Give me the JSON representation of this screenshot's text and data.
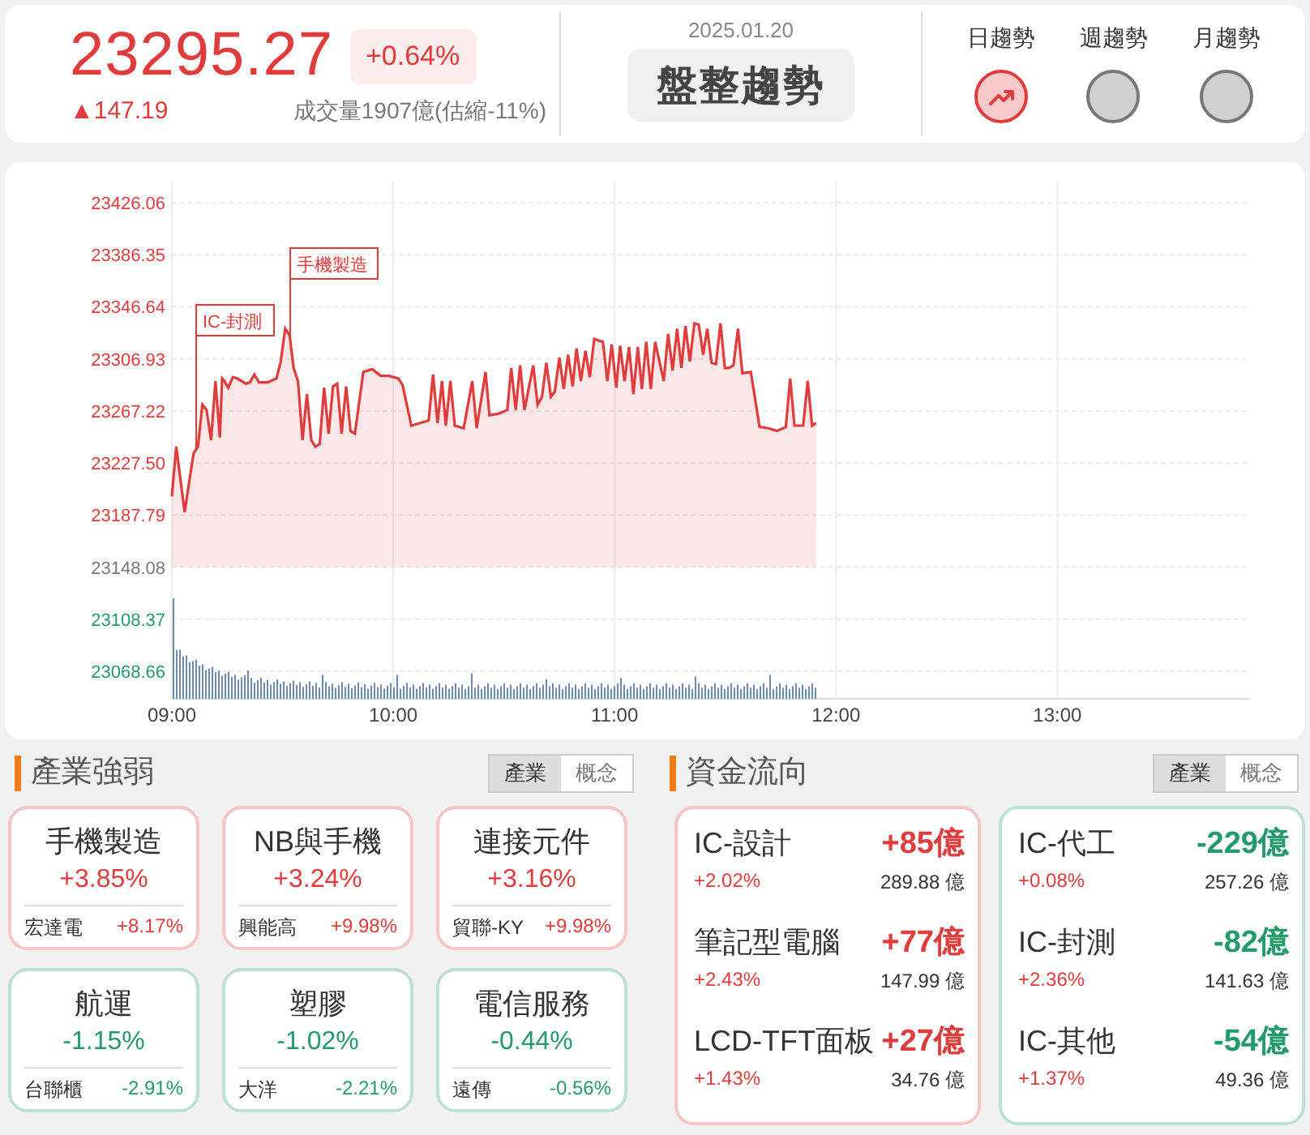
{
  "header": {
    "price": "23295.27",
    "change_percent": "+0.64%",
    "change": "▲147.19",
    "volume": "成交量1907億(估縮-11%)",
    "date": "2025.01.20",
    "status": "盤整趨勢",
    "trends": [
      {
        "label": "日趨勢",
        "selected": true
      },
      {
        "label": "週趨勢",
        "selected": false
      },
      {
        "label": "月趨勢",
        "selected": false
      }
    ]
  },
  "chart": {
    "chart_data": {
      "type": "area",
      "xticks": [
        {
          "value": 9,
          "label": "09:00"
        },
        {
          "value": 10,
          "label": "10:00"
        },
        {
          "value": 11,
          "label": "11:00"
        },
        {
          "value": 12,
          "label": "12:00"
        },
        {
          "value": 13,
          "label": "13:00"
        }
      ],
      "yticks": [
        23426.06,
        23386.35,
        23346.64,
        23306.93,
        23267.22,
        {
          "value": 23227.5,
          "label": "23227.50"
        },
        23187.79,
        23148.08,
        23108.37,
        23068.66
      ],
      "xlim": [
        9,
        13.87
      ],
      "ylim": [
        23047.7,
        23442.1
      ],
      "grid": true,
      "series": [
        {
          "color": "#e03c3c",
          "x": [
            9,
            9.02,
            9.058,
            9.098,
            9.118,
            9.138,
            9.157,
            9.177,
            9.197,
            9.217,
            9.227,
            9.237,
            9.255,
            9.275,
            9.295,
            9.335,
            9.353,
            9.373,
            9.393,
            9.433,
            9.472,
            9.492,
            9.512,
            9.532,
            9.55,
            9.57,
            9.59,
            9.61,
            9.63,
            9.648,
            9.668,
            9.688,
            9.708,
            9.728,
            9.747,
            9.767,
            9.787,
            9.807,
            9.827,
            9.865,
            9.905,
            9.943,
            9.983,
            10.023,
            10.042,
            10.082,
            10.122,
            10.16,
            10.18,
            10.2,
            10.22,
            10.238,
            10.258,
            10.278,
            10.318,
            10.357,
            10.377,
            10.417,
            10.435,
            10.475,
            10.515,
            10.533,
            10.553,
            10.573,
            10.593,
            10.632,
            10.652,
            10.672,
            10.692,
            10.712,
            10.73,
            10.75,
            10.77,
            10.79,
            10.81,
            10.828,
            10.848,
            10.868,
            10.888,
            10.908,
            10.947,
            10.967,
            10.987,
            11.007,
            11.025,
            11.045,
            11.065,
            11.085,
            11.105,
            11.123,
            11.143,
            11.163,
            11.183,
            11.222,
            11.242,
            11.262,
            11.282,
            11.302,
            11.32,
            11.34,
            11.36,
            11.38,
            11.4,
            11.418,
            11.438,
            11.458,
            11.478,
            11.498,
            11.517,
            11.537,
            11.557,
            11.577,
            11.615,
            11.655,
            11.695,
            11.733,
            11.773,
            11.793,
            11.812,
            11.852,
            11.872,
            11.892,
            11.91
          ],
          "values": [
            23202,
            23240,
            23190,
            23235,
            23240,
            23272,
            23268,
            23245,
            23290,
            23247,
            23292,
            23290,
            23285,
            23293,
            23292,
            23288,
            23289,
            23295,
            23289,
            23289,
            23292,
            23305,
            23330,
            23325,
            23300,
            23290,
            23245,
            23280,
            23245,
            23240,
            23242,
            23285,
            23250,
            23286,
            23288,
            23250,
            23286,
            23252,
            23250,
            23297,
            23299,
            23294,
            23294,
            23292,
            23287,
            23256,
            23258,
            23260,
            23295,
            23258,
            23290,
            23256,
            23290,
            23256,
            23254,
            23290,
            23254,
            23297,
            23264,
            23265,
            23268,
            23300,
            23268,
            23302,
            23268,
            23302,
            23272,
            23278,
            23304,
            23278,
            23282,
            23308,
            23284,
            23310,
            23286,
            23315,
            23290,
            23313,
            23293,
            23322,
            23320,
            23290,
            23318,
            23285,
            23317,
            23290,
            23316,
            23280,
            23316,
            23284,
            23320,
            23284,
            23320,
            23290,
            23326,
            23298,
            23330,
            23300,
            23332,
            23305,
            23334,
            23333,
            23310,
            23330,
            23304,
            23303,
            23334,
            23300,
            23300,
            23302,
            23330,
            23296,
            23297,
            23255,
            23254,
            23252,
            23255,
            23292,
            23256,
            23256,
            23290,
            23256,
            23258
          ]
        }
      ],
      "annotations": [
        "手機製造",
        "IC-封測"
      ]
    }
  },
  "sectors": {
    "title": "產業強弱",
    "toggle": [
      {
        "label": "產業",
        "selected": true
      },
      {
        "label": "概念",
        "selected": false
      }
    ],
    "cards": [
      {
        "name": "手機製造",
        "change": "+3.85%",
        "stock": "宏達電",
        "stock_change": "+8.17%",
        "color": "#e03c3c"
      },
      {
        "name": "NB與手機",
        "change": "+3.24%",
        "stock": "興能高",
        "stock_change": "+9.98%",
        "color": "#e03c3c"
      },
      {
        "name": "連接元件",
        "change": "+3.16%",
        "stock": "貿聯-KY",
        "stock_change": "+9.98%",
        "color": "#e03c3c"
      },
      {
        "name": "航運",
        "change": "-1.15%",
        "stock": "台聯櫃",
        "stock_change": "-2.91%",
        "color": "#239a6a"
      },
      {
        "name": "塑膠",
        "change": "-1.02%",
        "stock": "大洋",
        "stock_change": "-2.21%",
        "color": "#239a6a"
      },
      {
        "name": "電信服務",
        "change": "-0.44%",
        "stock": "遠傳",
        "stock_change": "-0.56%",
        "color": "#239a6a"
      }
    ]
  },
  "fund_flow": {
    "title": "資金流向",
    "toggle": [
      {
        "label": "產業",
        "selected": true
      },
      {
        "label": "概念",
        "selected": false
      }
    ],
    "groups": [
      {
        "color": "#e03c3c",
        "items": [
          {
            "name": "IC-設計",
            "flow": "+85億",
            "change": "+2.02%",
            "turnover": "289.88 億"
          },
          {
            "name": "筆記型電腦",
            "flow": "+77億",
            "change": "+2.43%",
            "turnover": "147.99 億"
          },
          {
            "name": "LCD-TFT面板",
            "flow": "+27億",
            "change": "+1.43%",
            "turnover": "34.76 億"
          }
        ]
      },
      {
        "color": "#239a6a",
        "items": [
          {
            "name": "IC-代工",
            "flow": "-229億",
            "change": "+0.08%",
            "turnover": "257.26 億"
          },
          {
            "name": "IC-封測",
            "flow": "-82億",
            "change": "+2.36%",
            "turnover": "141.63 億"
          },
          {
            "name": "IC-其他",
            "flow": "-54億",
            "change": "+1.37%",
            "turnover": "49.36 億"
          }
        ]
      }
    ]
  }
}
